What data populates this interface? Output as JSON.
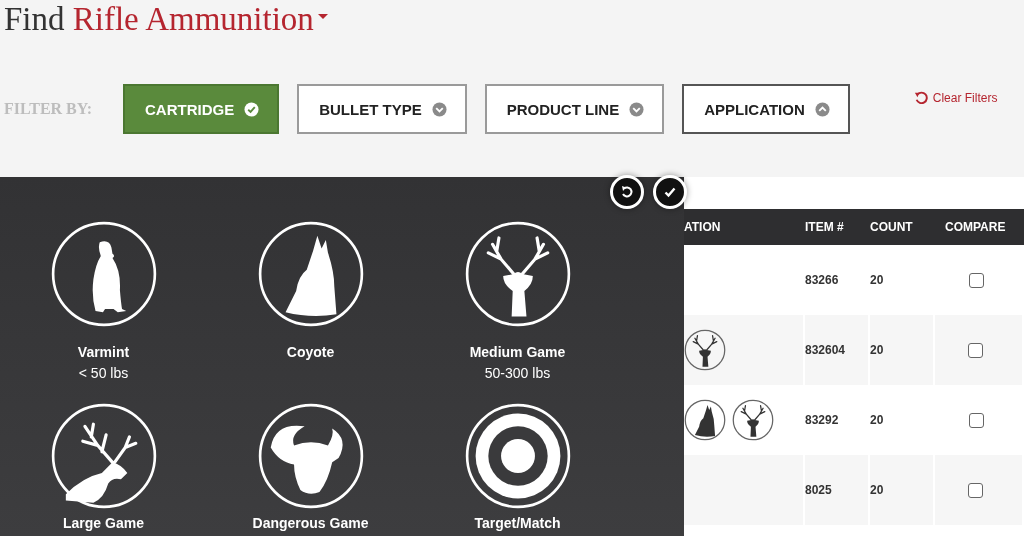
{
  "title": {
    "lead": "Find",
    "product": "Rifle Ammunition"
  },
  "filter_bar": {
    "label": "FILTER BY:",
    "filters": [
      {
        "label": "CARTRIDGE",
        "selected": true,
        "expanded": false
      },
      {
        "label": "BULLET TYPE",
        "selected": false,
        "expanded": false
      },
      {
        "label": "PRODUCT LINE",
        "selected": false,
        "expanded": false
      },
      {
        "label": "APPLICATION",
        "selected": false,
        "expanded": true
      }
    ],
    "clear": "Clear Filters"
  },
  "application_panel": {
    "options": [
      {
        "kind": "varmint",
        "label": "Varmint",
        "sublabel": "< 50 lbs"
      },
      {
        "kind": "coyote",
        "label": "Coyote"
      },
      {
        "kind": "deer",
        "label": "Medium Game",
        "sublabel": "50-300 lbs"
      },
      {
        "kind": "elk",
        "label": "Large Game"
      },
      {
        "kind": "buffalo",
        "label": "Dangerous Game"
      },
      {
        "kind": "target",
        "label": "Target/Match"
      }
    ]
  },
  "table": {
    "columns": [
      "ATION",
      "ITEM #",
      "COUNT",
      "COMPARE"
    ],
    "rows": [
      {
        "applications": [],
        "item": "83266",
        "count": "20",
        "compare": false
      },
      {
        "applications": [
          {
            "kind": "deer"
          }
        ],
        "item": "832604",
        "count": "20",
        "compare": false
      },
      {
        "applications": [
          {
            "kind": "coyote"
          },
          {
            "kind": "deer"
          }
        ],
        "item": "83292",
        "count": "20",
        "compare": false
      },
      {
        "applications": [],
        "item": "8025",
        "count": "20",
        "compare": false
      }
    ]
  }
}
